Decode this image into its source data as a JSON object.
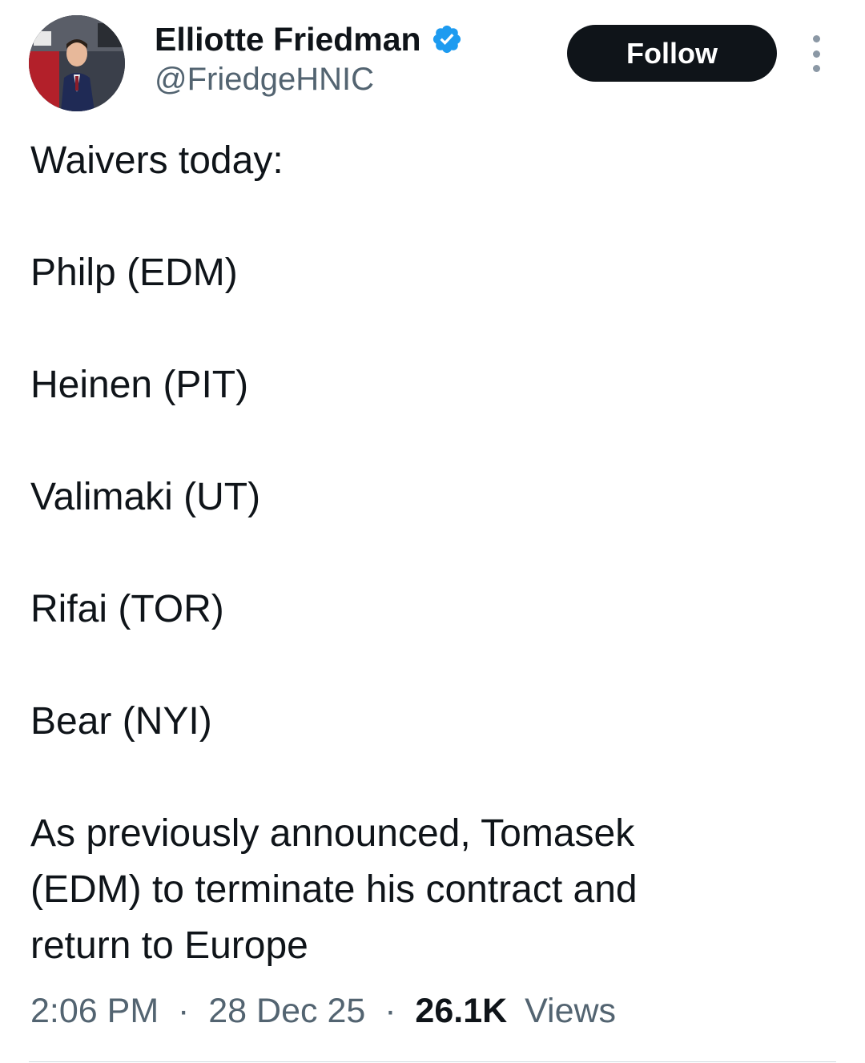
{
  "author": {
    "display_name": "Elliotte Friedman",
    "handle": "@FriedgeHNIC",
    "verified": true
  },
  "actions": {
    "follow_label": "Follow",
    "more_icon": "more-vertical-icon"
  },
  "tweet": {
    "lines": [
      "Waivers today:",
      "Philp (EDM)",
      "Heinen (PIT)",
      "Valimaki (UT)",
      "Rifai (TOR)",
      "Bear (NYI)",
      "As previously announced, Tomasek",
      "(EDM) to terminate his contract and",
      "return to Europe"
    ]
  },
  "meta": {
    "time": "2:06 PM",
    "separator": "·",
    "date": "28 Dec 25",
    "views_count": "26.1K",
    "views_label": "Views"
  },
  "colors": {
    "text_primary": "#0f1419",
    "text_secondary": "#536471",
    "verified_blue": "#1d9bf0",
    "button_bg": "#0f1419",
    "divider": "#cfd9de"
  }
}
